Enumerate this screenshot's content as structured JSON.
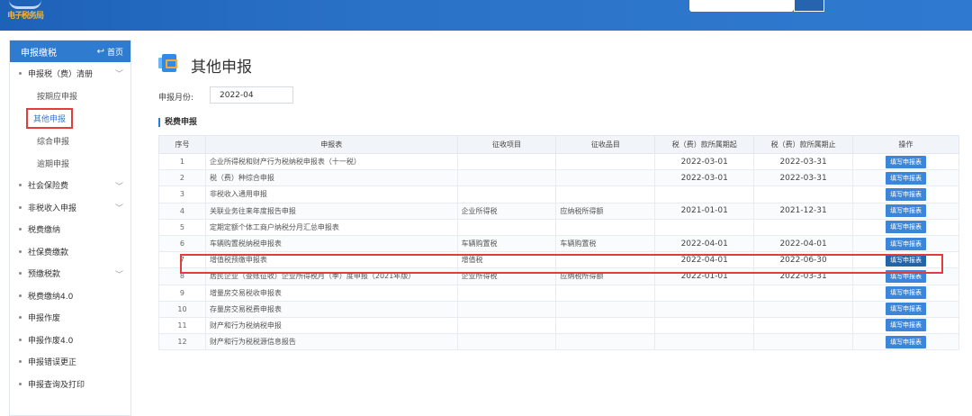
{
  "header": {
    "logo_text": "电子税务局",
    "search_placeholder": ""
  },
  "sidebar": {
    "title": "申报缴税",
    "home_label": "首页",
    "items": [
      {
        "label": "申报税（费）清册",
        "expandable": true
      },
      {
        "label": "按期应申报",
        "sub": true
      },
      {
        "label": "其他申报",
        "sub": true,
        "active": true
      },
      {
        "label": "综合申报",
        "sub": true
      },
      {
        "label": "逾期申报",
        "sub": true
      },
      {
        "label": "社会保险费",
        "expandable": true
      },
      {
        "label": "非税收入申报",
        "expandable": true
      },
      {
        "label": "税费缴纳"
      },
      {
        "label": "社保费缴款"
      },
      {
        "label": "预缴税款",
        "expandable": true
      },
      {
        "label": "税费缴纳4.0"
      },
      {
        "label": "申报作废"
      },
      {
        "label": "申报作废4.0"
      },
      {
        "label": "申报错误更正"
      },
      {
        "label": "申报查询及打印"
      }
    ]
  },
  "main": {
    "title": "其他申报",
    "month_label": "申报月份:",
    "month_value": "2022-04",
    "section_title": "税费申报",
    "columns": [
      "序号",
      "申报表",
      "征收项目",
      "征收品目",
      "税（费）款所属期起",
      "税（费）款所属期止",
      "操作"
    ],
    "button_label": "填写申报表",
    "rows": [
      {
        "no": "1",
        "form": "企业所得税和财产行为税纳税申报表（十一税）",
        "item": "",
        "subitem": "",
        "start": "2022-03-01",
        "end": "2022-03-31"
      },
      {
        "no": "2",
        "form": "税（费）种综合申报",
        "item": "",
        "subitem": "",
        "start": "2022-03-01",
        "end": "2022-03-31"
      },
      {
        "no": "3",
        "form": "非税收入通用申报",
        "item": "",
        "subitem": "",
        "start": "",
        "end": ""
      },
      {
        "no": "4",
        "form": "关联业务往来年度报告申报",
        "item": "企业所得税",
        "subitem": "应纳税所得额",
        "start": "2021-01-01",
        "end": "2021-12-31"
      },
      {
        "no": "5",
        "form": "定期定额个体工商户纳税分月汇总申报表",
        "item": "",
        "subitem": "",
        "start": "",
        "end": ""
      },
      {
        "no": "6",
        "form": "车辆购置税纳税申报表",
        "item": "车辆购置税",
        "subitem": "车辆购置税",
        "start": "2022-04-01",
        "end": "2022-04-01"
      },
      {
        "no": "7",
        "form": "增值税预缴申报表",
        "item": "增值税",
        "subitem": "",
        "start": "2022-04-01",
        "end": "2022-06-30",
        "highlighted": true
      },
      {
        "no": "8",
        "form": "居民企业（查账征收）企业所得税月（季）度申报（2021年版）",
        "item": "企业所得税",
        "subitem": "应纳税所得额",
        "start": "2022-01-01",
        "end": "2022-03-31"
      },
      {
        "no": "9",
        "form": "增量房交易税收申报表",
        "item": "",
        "subitem": "",
        "start": "",
        "end": ""
      },
      {
        "no": "10",
        "form": "存量房交易税费申报表",
        "item": "",
        "subitem": "",
        "start": "",
        "end": ""
      },
      {
        "no": "11",
        "form": "财产和行为税纳税申报",
        "item": "",
        "subitem": "",
        "start": "",
        "end": ""
      },
      {
        "no": "12",
        "form": "财产和行为税税源信息报告",
        "item": "",
        "subitem": "",
        "start": "",
        "end": ""
      }
    ]
  },
  "colors": {
    "primary": "#2f7bd0",
    "highlight": "#e23c3c"
  }
}
